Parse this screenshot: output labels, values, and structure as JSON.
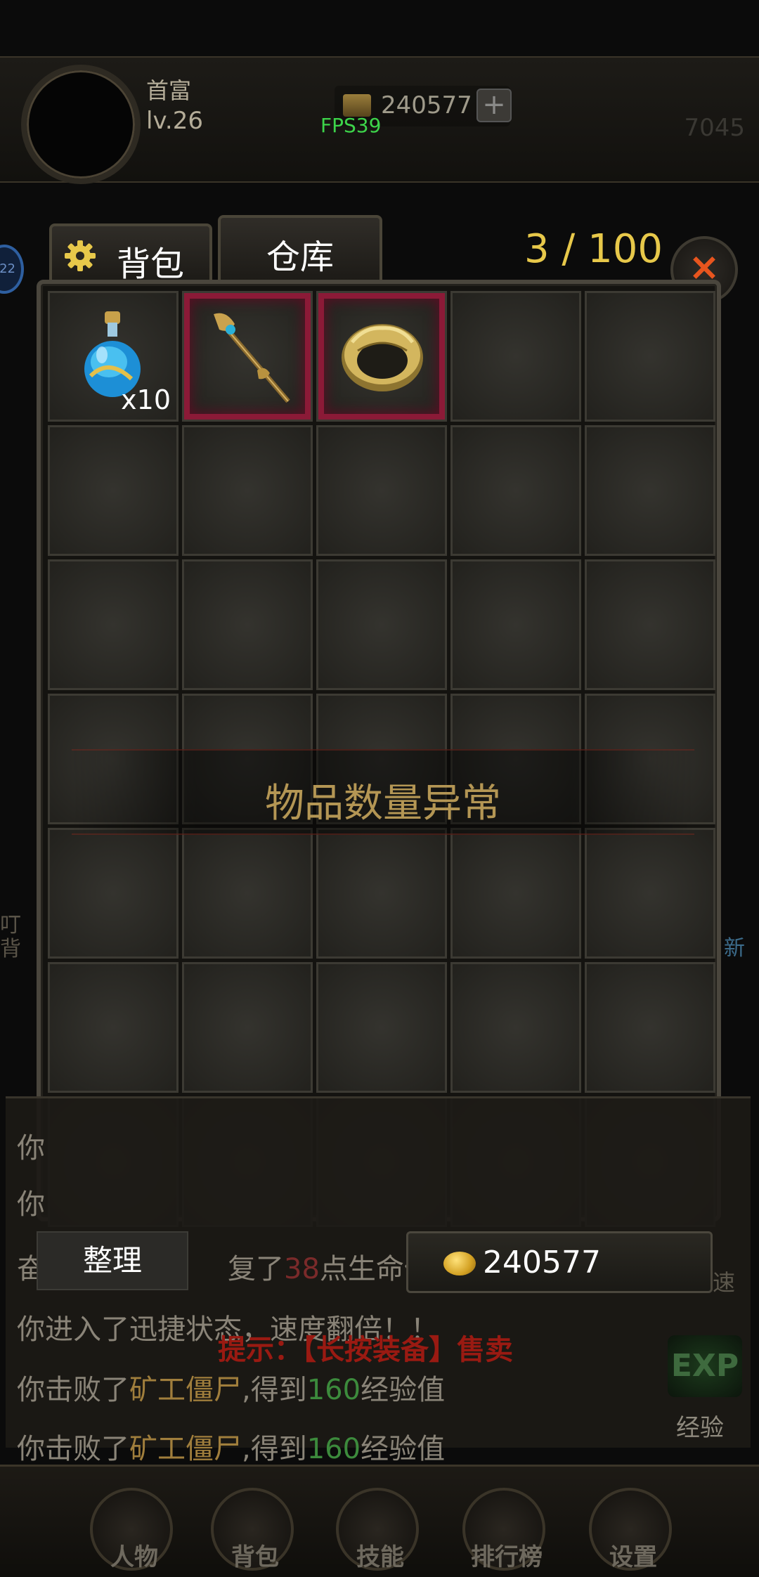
{
  "hud": {
    "title": "首富",
    "level": "lv.26",
    "gold": "240577",
    "plus": "+",
    "fps": "FPS39",
    "power": "7045"
  },
  "side_badge": "22",
  "tabs": [
    {
      "label": "背包",
      "icon": "gear-icon",
      "active": true
    },
    {
      "label": "仓库",
      "active": false
    }
  ],
  "capacity": "3 / 100",
  "close_label": "×",
  "inventory": {
    "items": [
      {
        "slot": 1,
        "icon": "potion-icon",
        "quantity": "x10",
        "equip": false
      },
      {
        "slot": 2,
        "icon": "staff-icon",
        "equip": true
      },
      {
        "slot": 3,
        "icon": "ring-icon",
        "equip": true
      }
    ],
    "total_slots": 35,
    "warning": "物品数量异常"
  },
  "sort_button": "整理",
  "gold_balance": "240577",
  "log": {
    "line1": "你",
    "line2": "你",
    "line3": {
      "prefix": "奋",
      "mid": "复了",
      "value": "38",
      "suffix": "点生命值"
    },
    "line4": "你进入了迅捷状态，速度翻倍！！",
    "line5": {
      "a": "你击败了",
      "monster": "矿工僵尸",
      "b": ",得到",
      "exp": "160",
      "c": "经验值"
    },
    "line6": {
      "a": "你击败了",
      "monster": "矿工僵尸",
      "b": ",得到",
      "exp": "160",
      "c": "经验值"
    }
  },
  "tip": "提示：【长按装备】售卖",
  "exp_badge": "EXP",
  "exp_label": "经验",
  "edge": {
    "left": "叮\n背",
    "right": "新",
    "speed": "速"
  },
  "nav": [
    {
      "label": "人物"
    },
    {
      "label": "背包"
    },
    {
      "label": "技能"
    },
    {
      "label": "排行榜"
    },
    {
      "label": "设置"
    }
  ],
  "colors": {
    "accent_gold": "#e7c84a",
    "close": "#e8551e",
    "fps": "#3dd44a",
    "equip_border": "#8b1a37"
  }
}
